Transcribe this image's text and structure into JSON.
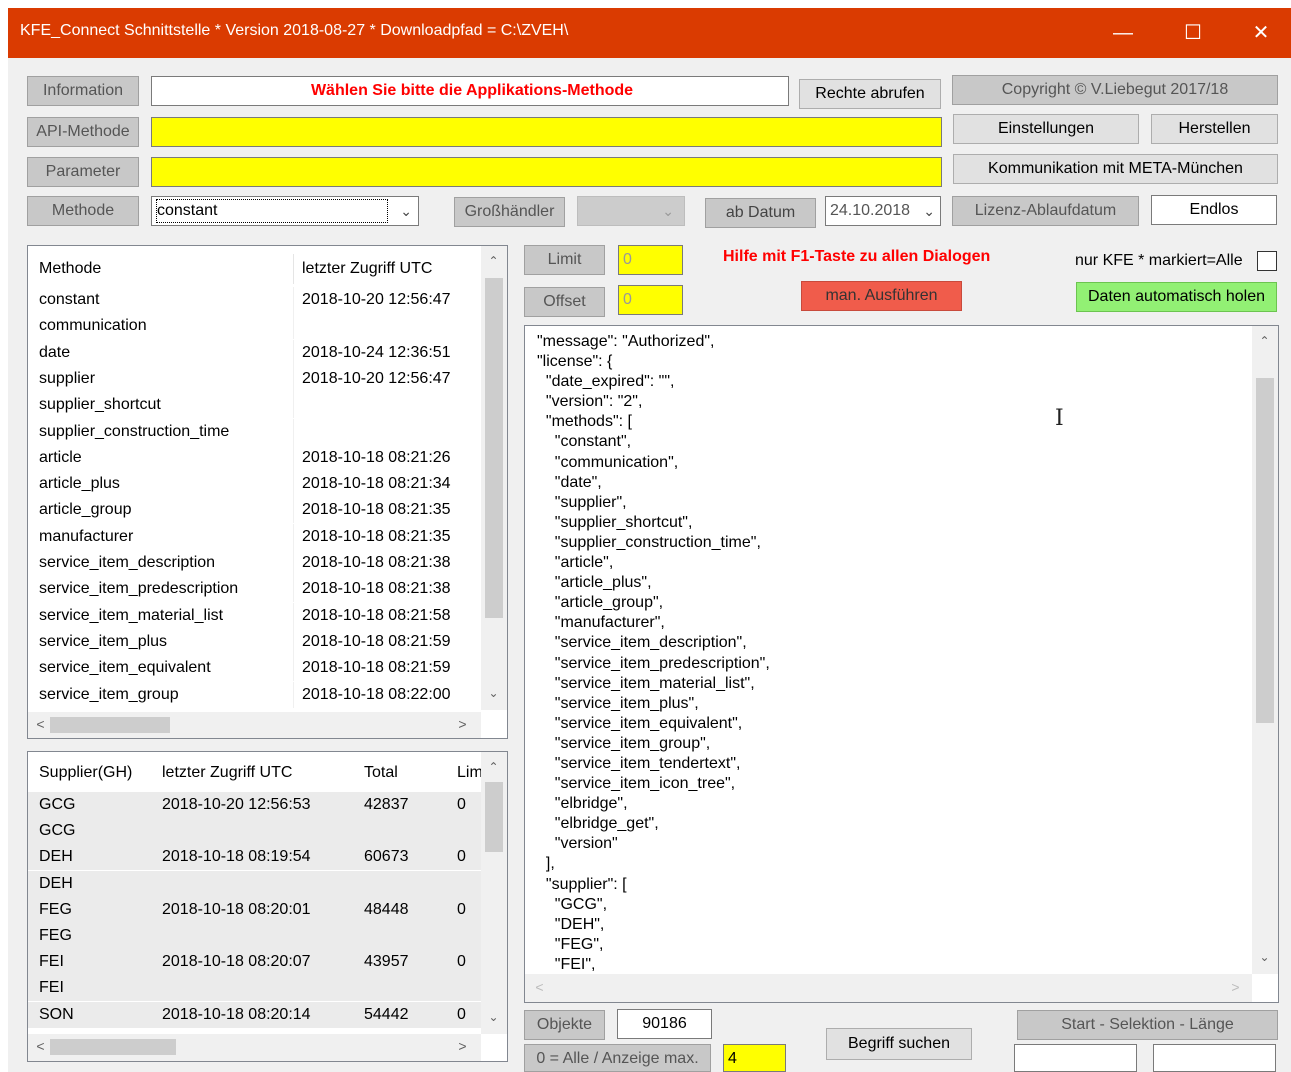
{
  "window": {
    "title": "KFE_Connect Schnittstelle * Version 2018-08-27 * Downloadpfad = C:\\ZVEH\\",
    "accent": "#da3b01"
  },
  "top": {
    "information_label": "Information",
    "information_text": "Wählen Sie bitte die Applikations-Methode",
    "rechte_button": "Rechte abrufen",
    "copyright_button": "Copyright © V.Liebegut 2017/18",
    "api_label": "API-Methode",
    "api_value": "",
    "einstellungen_button": "Einstellungen",
    "herstellen_button": "Herstellen",
    "parameter_label": "Parameter",
    "parameter_value": "",
    "kommunikation_button": "Kommunikation mit META-München",
    "methode_label": "Methode",
    "methode_value": "constant",
    "grosshaendler_label": "Großhändler",
    "grosshaendler_value": "",
    "ab_datum_button": "ab Datum",
    "datum_value": "24.10.2018",
    "lizenz_button": "Lizenz-Ablaufdatum",
    "lizenz_value": "Endlos"
  },
  "controls": {
    "limit_label": "Limit",
    "limit_value": "0",
    "offset_label": "Offset",
    "offset_value": "0",
    "hilfe_text": "Hilfe mit F1-Taste zu allen Dialogen",
    "man_button": "man. Ausführen",
    "nur_kfe_label": "nur KFE * markiert=Alle",
    "nur_kfe_checked": false,
    "daten_button": "Daten automatisch holen"
  },
  "methods_table": {
    "headers": [
      "Methode",
      "letzter Zugriff UTC"
    ],
    "rows": [
      [
        "constant",
        "2018-10-20 12:56:47"
      ],
      [
        "communication",
        ""
      ],
      [
        "date",
        "2018-10-24 12:36:51"
      ],
      [
        "supplier",
        "2018-10-20 12:56:47"
      ],
      [
        "supplier_shortcut",
        ""
      ],
      [
        "supplier_construction_time",
        ""
      ],
      [
        "article",
        "2018-10-18 08:21:26"
      ],
      [
        "article_plus",
        "2018-10-18 08:21:34"
      ],
      [
        "article_group",
        "2018-10-18 08:21:35"
      ],
      [
        "manufacturer",
        "2018-10-18 08:21:35"
      ],
      [
        "service_item_description",
        "2018-10-18 08:21:38"
      ],
      [
        "service_item_predescription",
        "2018-10-18 08:21:38"
      ],
      [
        "service_item_material_list",
        "2018-10-18 08:21:58"
      ],
      [
        "service_item_plus",
        "2018-10-18 08:21:59"
      ],
      [
        "service_item_equivalent",
        "2018-10-18 08:21:59"
      ],
      [
        "service_item_group",
        "2018-10-18 08:22:00"
      ]
    ]
  },
  "supplier_table": {
    "headers": [
      "Supplier(GH)",
      "letzter Zugriff UTC",
      "Total",
      "Lim"
    ],
    "rows": [
      [
        "GCG",
        "2018-10-20 12:56:53",
        "42837",
        "0"
      ],
      [
        "GCG",
        "",
        "",
        ""
      ],
      [
        "DEH",
        "2018-10-18 08:19:54",
        "60673",
        "0"
      ],
      [
        "DEH",
        "",
        "",
        ""
      ],
      [
        "FEG",
        "2018-10-18 08:20:01",
        "48448",
        "0"
      ],
      [
        "FEG",
        "",
        "",
        ""
      ],
      [
        "FEI",
        "2018-10-18 08:20:07",
        "43957",
        "0"
      ],
      [
        "FEI",
        "",
        "",
        ""
      ],
      [
        "SON",
        "2018-10-18 08:20:14",
        "54442",
        "0"
      ]
    ]
  },
  "json_output": "\"message\": \"Authorized\",\n\"license\": {\n  \"date_expired\": \"\",\n  \"version\": \"2\",\n  \"methods\": [\n    \"constant\",\n    \"communication\",\n    \"date\",\n    \"supplier\",\n    \"supplier_shortcut\",\n    \"supplier_construction_time\",\n    \"article\",\n    \"article_plus\",\n    \"article_group\",\n    \"manufacturer\",\n    \"service_item_description\",\n    \"service_item_predescription\",\n    \"service_item_material_list\",\n    \"service_item_plus\",\n    \"service_item_equivalent\",\n    \"service_item_group\",\n    \"service_item_tendertext\",\n    \"service_item_icon_tree\",\n    \"elbridge\",\n    \"elbridge_get\",\n    \"version\"\n  ],\n  \"supplier\": [\n    \"GCG\",\n    \"DEH\",\n    \"FEG\",\n    \"FEI\",",
  "bottom": {
    "objekte_label": "Objekte",
    "objekte_value": "90186",
    "anzeige_label": "0 = Alle / Anzeige max.",
    "anzeige_value": "4",
    "begriff_button": "Begriff suchen",
    "selektion_label": "Start - Selektion - Länge",
    "start_value": "",
    "laenge_value": ""
  },
  "icons": {
    "minimize": "minimize-icon",
    "maximize": "maximize-icon",
    "close": "close-icon",
    "dropdown": "chevron-down-icon",
    "text_cursor": "text-cursor-icon"
  }
}
